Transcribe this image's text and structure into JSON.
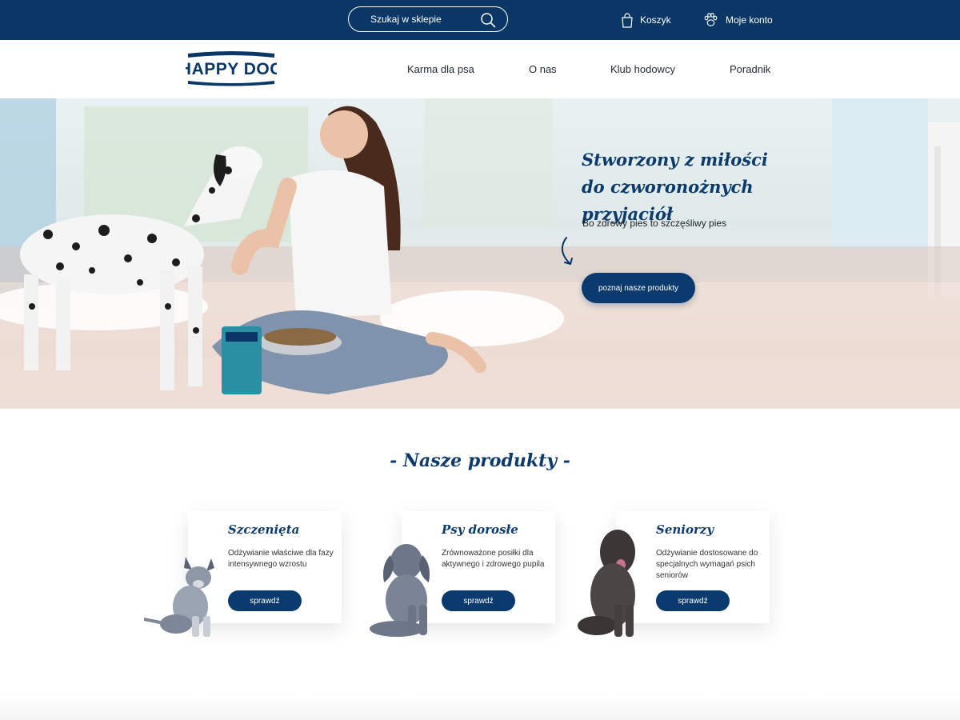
{
  "topbar": {
    "search_placeholder": "Szukaj w sklepie",
    "cart_label": "Koszyk",
    "account_label": "Moje konto"
  },
  "brand": {
    "logo_text": "HAPPY DOG",
    "color": "#0a3766"
  },
  "nav": {
    "items": [
      {
        "label": "Karma dla psa"
      },
      {
        "label": "O nas"
      },
      {
        "label": "Klub hodowcy"
      },
      {
        "label": "Poradnik"
      }
    ]
  },
  "hero": {
    "title_line1": "Stworzony z miłości",
    "title_line2": "do czworonożnych przyjaciół",
    "subtitle": "Bo zdrowy pies to szczęśliwy pies",
    "cta_label": "poznaj nasze produkty"
  },
  "products": {
    "section_title": "- Nasze produkty -",
    "cards": [
      {
        "title": "Szczenięta",
        "description": "Odżywianie właściwe dla fazy intensywnego wzrostu",
        "button": "sprawdź"
      },
      {
        "title": "Psy dorosłe",
        "description": "Zrównoważone posiłki dla aktywnego i zdrowego pupila",
        "button": "sprawdź"
      },
      {
        "title": "Seniorzy",
        "description": "Odżywianie dostosowane do specjalnych wymagań psich seniorów",
        "button": "sprawdź"
      }
    ]
  },
  "colors": {
    "accent": "#0a3a6e",
    "topbar": "#0a3766"
  },
  "icons": [
    "search-icon",
    "shopping-bag-icon",
    "paw-icon",
    "curved-arrow-icon"
  ]
}
